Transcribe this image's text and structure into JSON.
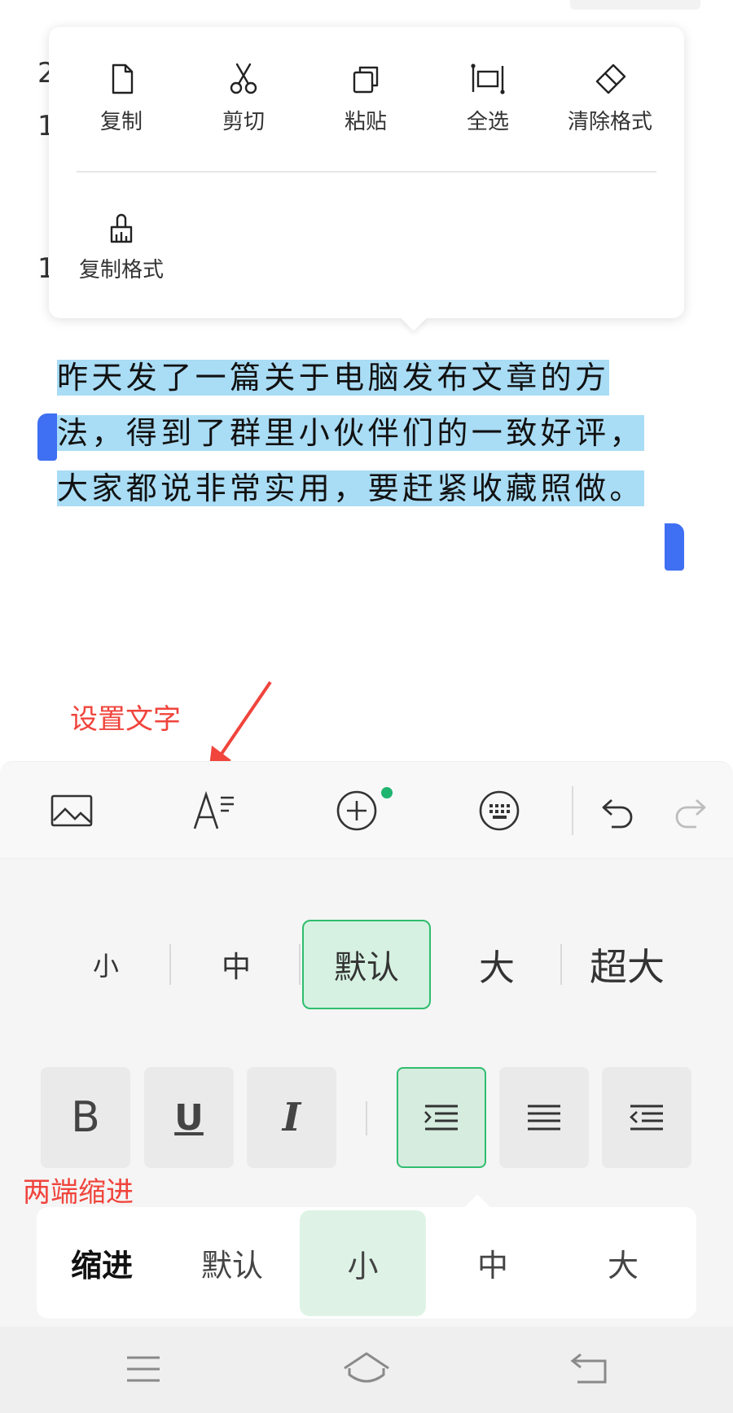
{
  "context_menu": {
    "items": [
      {
        "label": "复制",
        "icon": "copy-file-icon"
      },
      {
        "label": "剪切",
        "icon": "scissors-icon"
      },
      {
        "label": "粘贴",
        "icon": "paste-icon"
      },
      {
        "label": "全选",
        "icon": "select-all-icon"
      },
      {
        "label": "清除格式",
        "icon": "eraser-icon"
      },
      {
        "label": "复制格式",
        "icon": "format-painter-icon"
      }
    ]
  },
  "document": {
    "selected_lines": [
      "昨天发了一篇关于电脑发布文章的方",
      "法，得到了群里小伙伴们的一致好评，",
      "大家都说非常实用，要赶紧收藏照做。"
    ],
    "edge_glyphs": [
      "2",
      "1",
      "1"
    ]
  },
  "annotations": {
    "set_text": "设置文字",
    "justify_indent": "两端缩进"
  },
  "toolbar": {
    "icons": [
      "image-icon",
      "text-format-icon",
      "insert-plus-icon",
      "keyboard-icon",
      "undo-icon",
      "redo-icon"
    ],
    "insert_has_notification": true
  },
  "font_size": {
    "options": [
      "小",
      "中",
      "默认",
      "大",
      "超大"
    ],
    "selected": "默认"
  },
  "format_buttons": {
    "bold": "B",
    "underline": "U",
    "italic": "I",
    "align_active": "justify-indent"
  },
  "indent": {
    "title": "缩进",
    "options": [
      "默认",
      "小",
      "中",
      "大"
    ],
    "selected": "小"
  },
  "colors": {
    "accent_green": "#2fbd6e",
    "selection_blue": "#a9dcf5",
    "handle_blue": "#3f6ff2",
    "annotation_red": "#f0443c"
  },
  "navbar": {
    "icons": [
      "menu-icon",
      "home-icon",
      "back-icon"
    ]
  }
}
